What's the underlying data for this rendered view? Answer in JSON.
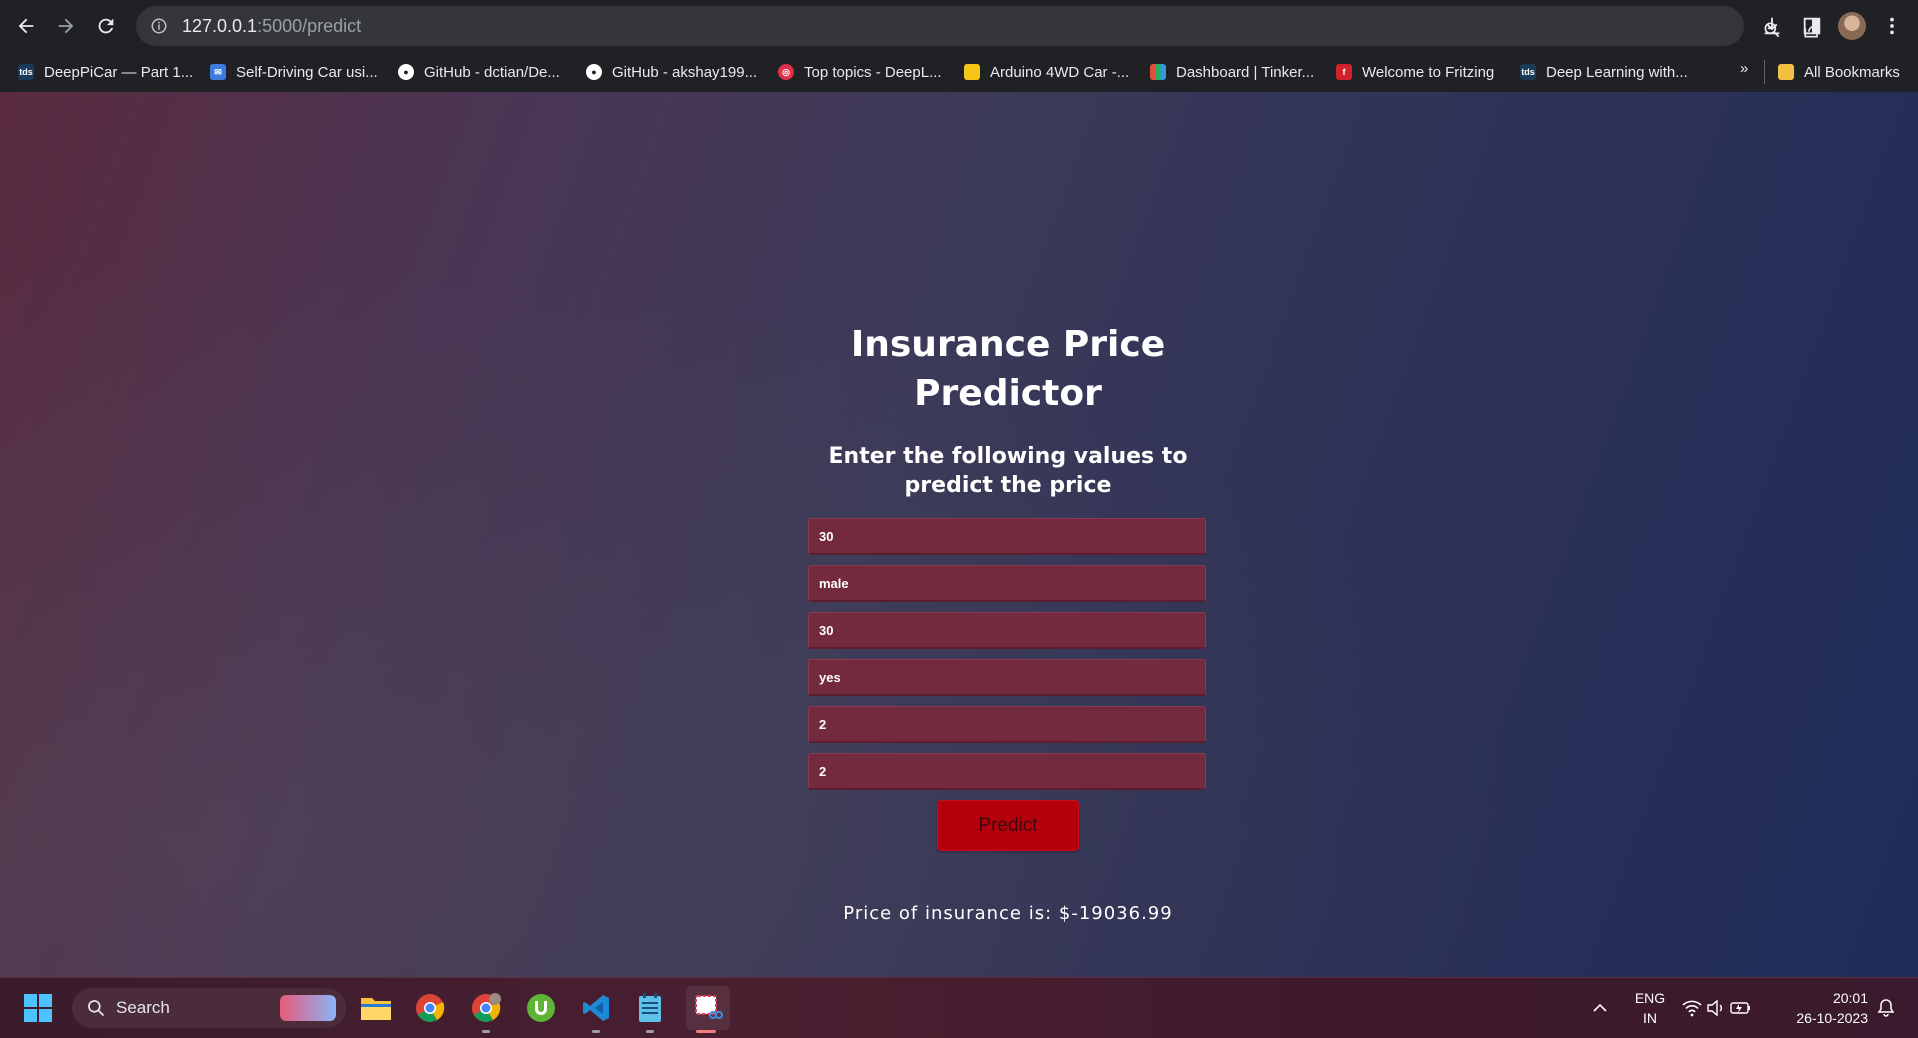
{
  "browser": {
    "url_host": "127.0.0.1",
    "url_path": ":5000/predict",
    "bookmarks": [
      {
        "label": "DeepPiCar — Part 1...",
        "icon": "tds-icon",
        "color": "#1b3a57",
        "badge": "tds"
      },
      {
        "label": "Self-Driving Car usi...",
        "icon": "mail-icon",
        "color": "#3d7be0",
        "badge": ""
      },
      {
        "label": "GitHub - dctian/De...",
        "icon": "github-icon",
        "color": "#ffffff",
        "badge": ""
      },
      {
        "label": "GitHub - akshay199...",
        "icon": "github-icon",
        "color": "#ffffff",
        "badge": ""
      },
      {
        "label": "Top topics - DeepL...",
        "icon": "deeplearning-icon",
        "color": "#e0304a",
        "badge": ""
      },
      {
        "label": "Arduino 4WD Car -...",
        "icon": "instructables-icon",
        "color": "#f5c518",
        "badge": ""
      },
      {
        "label": "Dashboard | Tinker...",
        "icon": "tinkercad-icon",
        "color": "#e8a020",
        "badge": ""
      },
      {
        "label": "Welcome to Fritzing",
        "icon": "fritzing-icon",
        "color": "#d0202a",
        "badge": "f"
      },
      {
        "label": "Deep Learning with...",
        "icon": "tds-icon",
        "color": "#1b3a57",
        "badge": "tds"
      }
    ],
    "more_label": "»",
    "all_bookmarks_label": "All Bookmarks"
  },
  "page": {
    "title": "Insurance Price Predictor",
    "subtitle": "Enter the following values to predict the price",
    "fields": [
      "30",
      "male",
      "30",
      "yes",
      "2",
      "2"
    ],
    "predict_label": "Predict",
    "result": "Price of insurance is: $-19036.99"
  },
  "taskbar": {
    "search_label": "Search",
    "lang_top": "ENG",
    "lang_bottom": "IN",
    "time": "20:01",
    "date": "26-10-2023"
  }
}
